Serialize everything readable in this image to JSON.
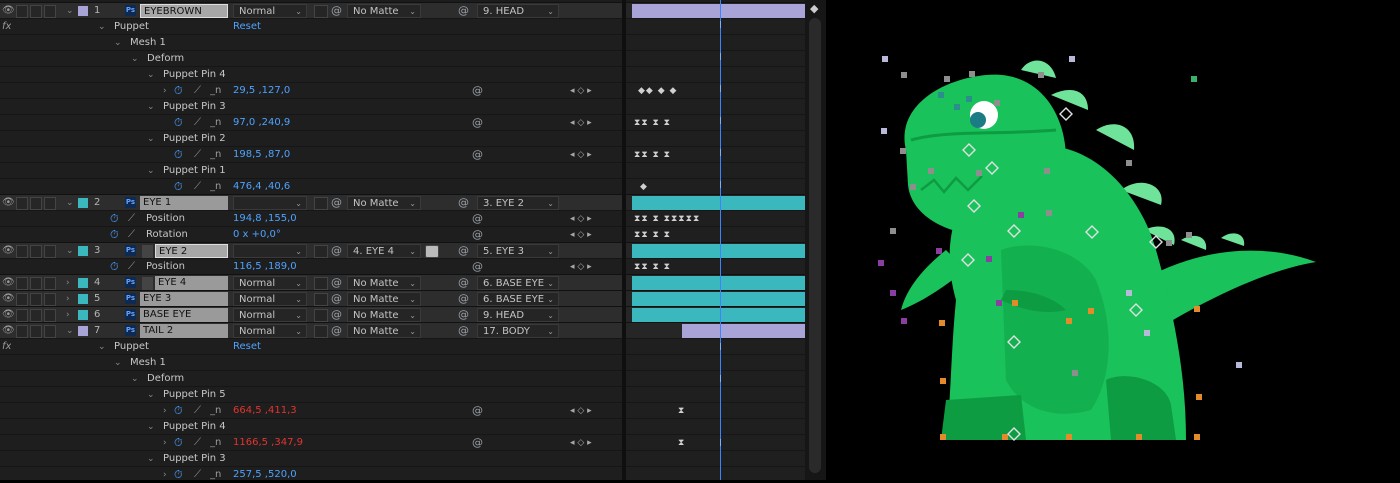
{
  "fx_label": "fx",
  "colors": {
    "lavender": "#a9a4d8",
    "teal": "#3bb8bd",
    "blue": "#4da3ff",
    "red": "#e3342f",
    "dino": "#19c25a",
    "dino_dark": "#0e9c43",
    "spike": "#6fe39a"
  },
  "timeline_icon": "cti-marker-icon",
  "layers": [
    {
      "num": "1",
      "name": "EYEBROWN",
      "mode": "Normal",
      "matte": "No Matte",
      "parent": "9. HEAD"
    },
    {
      "num": "2",
      "name": "EYE 1",
      "mode": "",
      "matte": "No Matte",
      "parent": "3. EYE 2"
    },
    {
      "num": "3",
      "name": "EYE 2",
      "mode": "",
      "matte": "4. EYE 4",
      "parent": "5. EYE 3"
    },
    {
      "num": "4",
      "name": "EYE 4",
      "mode": "Normal",
      "matte": "No Matte",
      "parent": "6. BASE EYE"
    },
    {
      "num": "5",
      "name": "EYE 3",
      "mode": "Normal",
      "matte": "No Matte",
      "parent": "6. BASE EYE"
    },
    {
      "num": "6",
      "name": "BASE EYE",
      "mode": "Normal",
      "matte": "No Matte",
      "parent": "9. HEAD"
    },
    {
      "num": "7",
      "name": "TAIL 2",
      "mode": "Normal",
      "matte": "No Matte",
      "parent": "17. BODY"
    }
  ],
  "props": {
    "puppet": "Puppet",
    "reset": "Reset",
    "mesh": "Mesh 1",
    "deform": "Deform",
    "pin4": "Puppet Pin 4",
    "pin3": "Puppet Pin 3",
    "pin2": "Puppet Pin 2",
    "pin1": "Puppet Pin 1",
    "pin5": "Puppet Pin 5",
    "position": "Position",
    "rotation": "Rotation"
  },
  "values": {
    "eb_pin4": "29,5 ,127,0",
    "eb_pin3": "97,0 ,240,9",
    "eb_pin2": "198,5 ,87,0",
    "eb_pin1": "476,4 ,40,6",
    "eye1_pos": "194,8 ,155,0",
    "eye1_rot": "0 x +0,0°",
    "eye2_pos": "116,5 ,189,0",
    "tail_pin5": "664,5 ,411,3",
    "tail_pin4": "1166,5 ,347,9",
    "tail_pin3": "257,5 ,520,0"
  },
  "glyphs": {
    "eye": "👁",
    "down": "⌄",
    "right": "›",
    "stopwatch": "⏱",
    "graph": "⟋",
    "spiral": "@",
    "nav": "◂ ◇ ▸",
    "caret": "⌄",
    "n": "_n"
  }
}
